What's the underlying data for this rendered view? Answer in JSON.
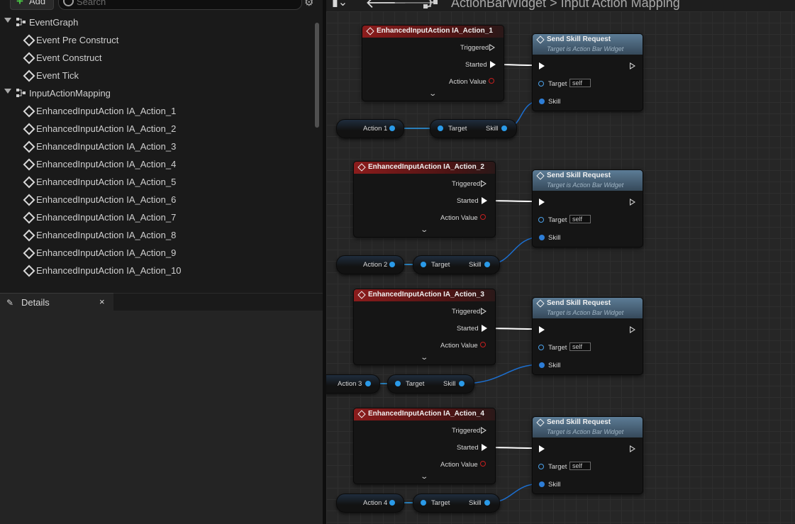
{
  "toolbar": {
    "add_label": "Add",
    "search_placeholder": "Search"
  },
  "tree": {
    "groups": [
      {
        "label": "EventGraph",
        "items": [
          "Event Pre Construct",
          "Event Construct",
          "Event Tick"
        ]
      },
      {
        "label": "InputActionMapping",
        "items": [
          "EnhancedInputAction IA_Action_1",
          "EnhancedInputAction IA_Action_2",
          "EnhancedInputAction IA_Action_3",
          "EnhancedInputAction IA_Action_4",
          "EnhancedInputAction IA_Action_5",
          "EnhancedInputAction IA_Action_6",
          "EnhancedInputAction IA_Action_7",
          "EnhancedInputAction IA_Action_8",
          "EnhancedInputAction IA_Action_9",
          "EnhancedInputAction IA_Action_10"
        ]
      }
    ]
  },
  "details": {
    "tab_label": "Details",
    "close": "×"
  },
  "graph": {
    "breadcrumb_root": "ActionBarWidget",
    "breadcrumb_sep": ">",
    "breadcrumb_current": "Input Action Mapping",
    "input_nodes": [
      {
        "title": "EnhancedInputAction IA_Action_1"
      },
      {
        "title": "EnhancedInputAction IA_Action_2"
      },
      {
        "title": "EnhancedInputAction IA_Action_3"
      },
      {
        "title": "EnhancedInputAction IA_Action_4"
      }
    ],
    "input_pins": {
      "triggered": "Triggered",
      "started": "Started",
      "action_value": "Action Value"
    },
    "call_node": {
      "title": "Send Skill Request",
      "subtitle": "Target is Action Bar Widget",
      "target": "Target",
      "self": "self",
      "skill": "Skill"
    },
    "variables": [
      "Action 1",
      "Action 2",
      "Action 3",
      "Action 4"
    ],
    "getter": {
      "target": "Target",
      "skill": "Skill"
    },
    "colors": {
      "exec": "#ffffff",
      "object_pin": "#2d7dd6",
      "event_header": "#8c1c1c",
      "function_header": "#5c7c96"
    }
  }
}
